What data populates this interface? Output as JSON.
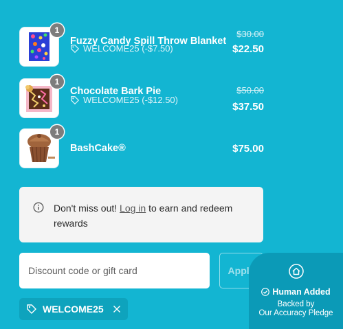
{
  "items": [
    {
      "name": "Fuzzy Candy Spill Throw Blanket",
      "quantity": "1",
      "discount": "WELCOME25 (-$7.50)",
      "original_price": "$30.00",
      "price": "$22.50"
    },
    {
      "name": "Chocolate Bark Pie",
      "quantity": "1",
      "discount": "WELCOME25 (-$12.50)",
      "original_price": "$50.00",
      "price": "$37.50"
    },
    {
      "name": "BashCake®",
      "quantity": "1",
      "price": "$75.00"
    }
  ],
  "rewards_notice": {
    "prefix": "Don't miss out!",
    "link": "Log in",
    "suffix": " to earn and redeem rewards"
  },
  "discount": {
    "placeholder": "Discount code or gift card",
    "apply_label": "Apply",
    "applied_code": "WELCOME25"
  },
  "pledge_badge": {
    "title": "Human Added",
    "line1": "Backed by",
    "line2": "Our Accuracy Pledge"
  },
  "colors": {
    "background": "#13b5d2",
    "chip": "#0ea3bd",
    "badge": "#0b9ab7",
    "qty_badge": "#7d7d7d"
  }
}
